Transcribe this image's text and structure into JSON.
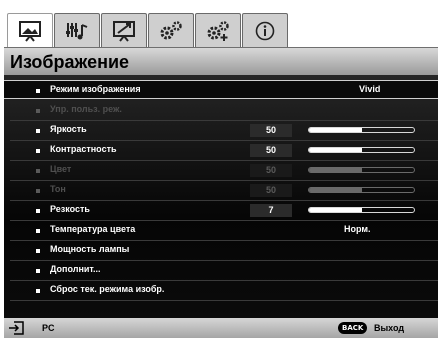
{
  "tabs": [
    {
      "icon": "picture-icon",
      "active": true
    },
    {
      "icon": "audio-settings-icon",
      "active": false
    },
    {
      "icon": "display-icon",
      "active": false
    },
    {
      "icon": "basic-settings-icon",
      "active": false
    },
    {
      "icon": "advanced-settings-icon",
      "active": false
    },
    {
      "icon": "info-icon",
      "active": false
    }
  ],
  "title": "Изображение",
  "menu": {
    "items": [
      {
        "label": "Режим изображения",
        "value": "Vivid",
        "selected": true,
        "enabled": true
      },
      {
        "label": "Упр. польз. реж.",
        "enabled": false
      },
      {
        "label": "Яркость",
        "value": "50",
        "level": 0.5,
        "enabled": true
      },
      {
        "label": "Контрастность",
        "value": "50",
        "level": 0.5,
        "enabled": true
      },
      {
        "label": "Цвет",
        "value": "50",
        "level": 0.5,
        "enabled": false
      },
      {
        "label": "Тон",
        "value": "50",
        "level": 0.5,
        "enabled": false
      },
      {
        "label": "Резкость",
        "value": "7",
        "level": 0.5,
        "enabled": true
      },
      {
        "label": "Температура цвета",
        "value": "Норм.",
        "enabled": true
      },
      {
        "label": "Мощность лампы",
        "enabled": true
      },
      {
        "label": "Дополнит...",
        "enabled": true
      },
      {
        "label": "Сброс тек. режима изобр.",
        "enabled": true
      }
    ]
  },
  "status": {
    "source_icon": "input-source-icon",
    "source_label": "PC",
    "back_button": "BACK",
    "back_label": "Выход"
  }
}
